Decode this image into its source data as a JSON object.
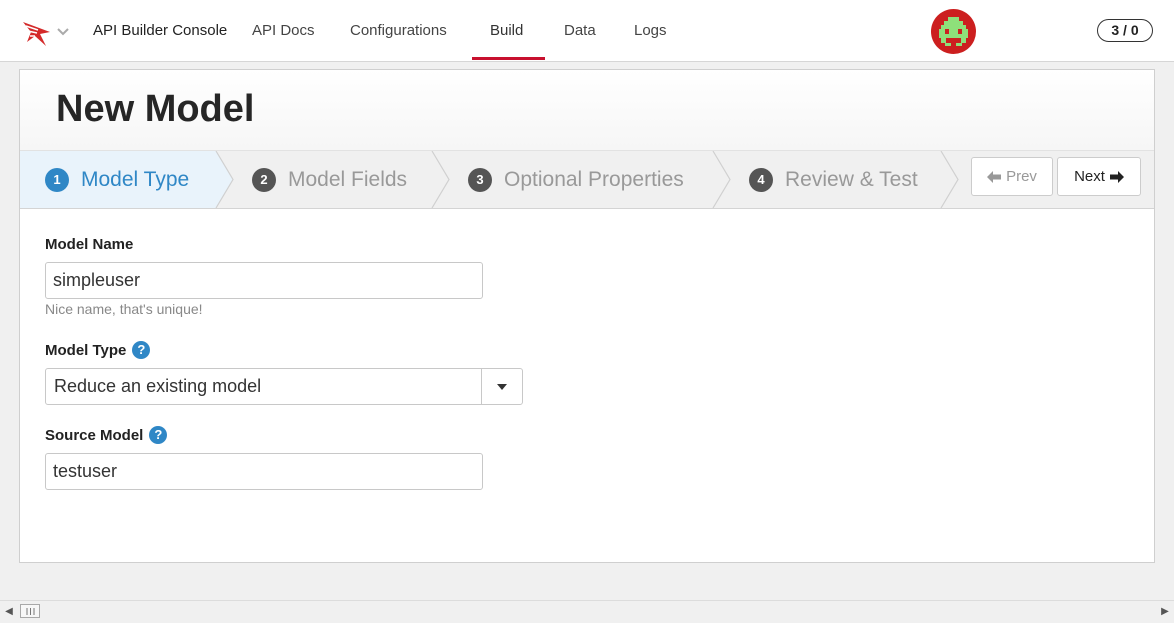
{
  "nav": {
    "brand": "API Builder Console",
    "links": [
      "API Docs",
      "Configurations",
      "Build",
      "Data",
      "Logs"
    ],
    "active": "Build",
    "counter": "3 / 0",
    "logo_icon": "api-builder-logo-icon",
    "avatar_icon": "space-invader-avatar-icon"
  },
  "page": {
    "title": "New Model"
  },
  "wizard": {
    "steps": [
      {
        "num": "1",
        "label": "Model Type"
      },
      {
        "num": "2",
        "label": "Model Fields"
      },
      {
        "num": "3",
        "label": "Optional Properties"
      },
      {
        "num": "4",
        "label": "Review & Test"
      }
    ],
    "active_step": 1,
    "prev_label": "Prev",
    "next_label": "Next"
  },
  "form": {
    "model_name": {
      "label": "Model Name",
      "value": "simpleuser",
      "hint": "Nice name, that's unique!"
    },
    "model_type": {
      "label": "Model Type",
      "value": "Reduce an existing model",
      "help": "?"
    },
    "source_model": {
      "label": "Source Model",
      "value": "testuser",
      "help": "?"
    }
  },
  "colors": {
    "accent": "#c8102e",
    "step_active": "#2f87c6",
    "help_icon": "#2f87c6"
  }
}
